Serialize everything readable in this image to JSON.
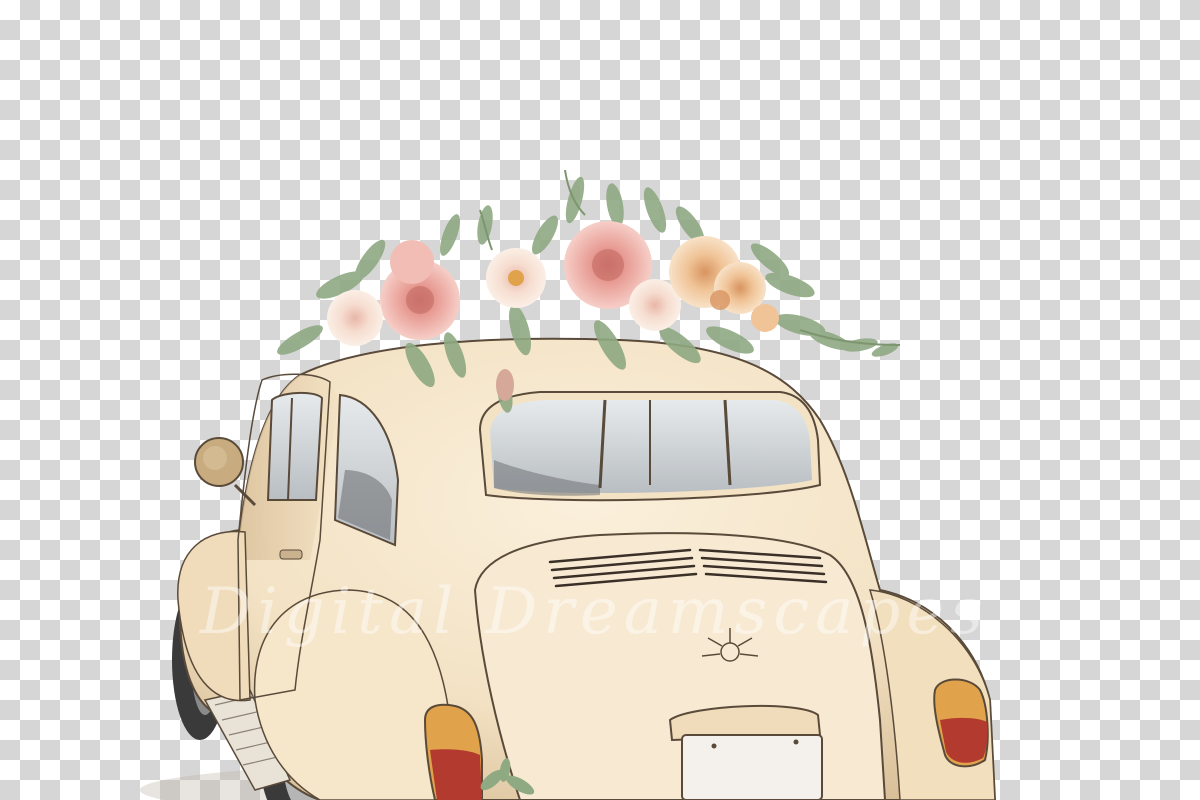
{
  "image": {
    "subject": "watercolor-vintage-beetle-car-with-flowers",
    "background": "transparency-checkerboard",
    "watermark": "Digital Dreamscapes"
  },
  "colors": {
    "checker_light": "#ffffff",
    "checker_dark": "#d6d6d6",
    "car_body": "#f3e2c4",
    "car_shadow": "#d9bf98",
    "outline": "#5a4a3a",
    "window_glass": "#d9dde0",
    "window_dark": "#6f7377",
    "taillight_red": "#b23a2e",
    "taillight_amber": "#e0a24a",
    "flower_pink": "#eaa7a0",
    "flower_peach": "#f2c8a0",
    "flower_cream": "#f4dcc0",
    "leaf_green": "#8fa982",
    "tire": "#3a3a3a"
  }
}
